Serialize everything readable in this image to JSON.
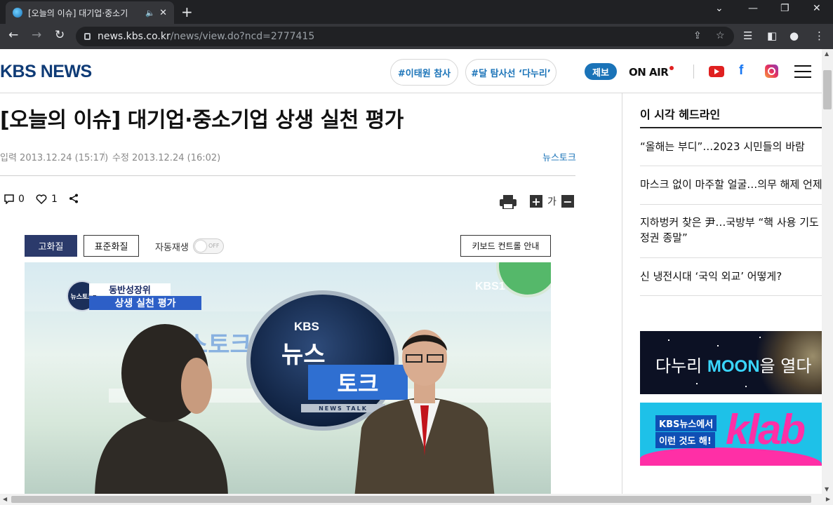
{
  "browser": {
    "tab_title": "[오늘의 이슈] 대기업·중소기",
    "new_tab": "+",
    "url_host": "news.kbs.co.kr",
    "url_path": "/news/view.do?ncd=2777415"
  },
  "header": {
    "logo": "KBS NEWS",
    "hashtags": [
      "#이태원 참사",
      "#달 탐사선 ‘다누리’"
    ],
    "jebo": "제보",
    "on_air": "ON AIR",
    "facebook": "f"
  },
  "article": {
    "title": "[오늘의 이슈] 대기업·중소기업 상생 실천 평가",
    "input_date": "입력 2013.12.24 (15:17)",
    "edit_date": "수정 2013.12.24 (16:02)",
    "program": "뉴스토크",
    "comment_count": "0",
    "like_count": "1",
    "font_label": "가"
  },
  "player": {
    "quality_high": "고화질",
    "quality_standard": "표준화질",
    "autoplay_label": "자동재생",
    "autoplay_state": "OFF",
    "keyboard_guide": "키보드 컨트롤 안내",
    "video": {
      "caption_top": "동반성장위",
      "caption_main": "상생 실천 평가",
      "badge": "뉴스토크",
      "logo_kbs": "KBS",
      "logo_news": "뉴스",
      "logo_talk": "토크",
      "logo_sub": "NEWS TALK",
      "ghost": "스토크",
      "channel": "KBS1"
    }
  },
  "sidebar": {
    "title": "이 시각 헤드라인",
    "headlines": [
      "“올해는 부디”…2023 시민들의 바람",
      "마스크 없이 마주할 얼굴…의무 해제 언제",
      "지하벙커 찾은 尹…국방부 “핵 사용 기도",
      "정권 종말”",
      "신 냉전시대 ‘국익 외교’ 어떻게?"
    ],
    "banner1_pre": "다누리 ",
    "banner1_bold": "MOON",
    "banner1_post": "을 열다",
    "banner2_line1": "KBS뉴스에서",
    "banner2_line2": "이런 것도 해!",
    "banner2_brand": "klab"
  }
}
